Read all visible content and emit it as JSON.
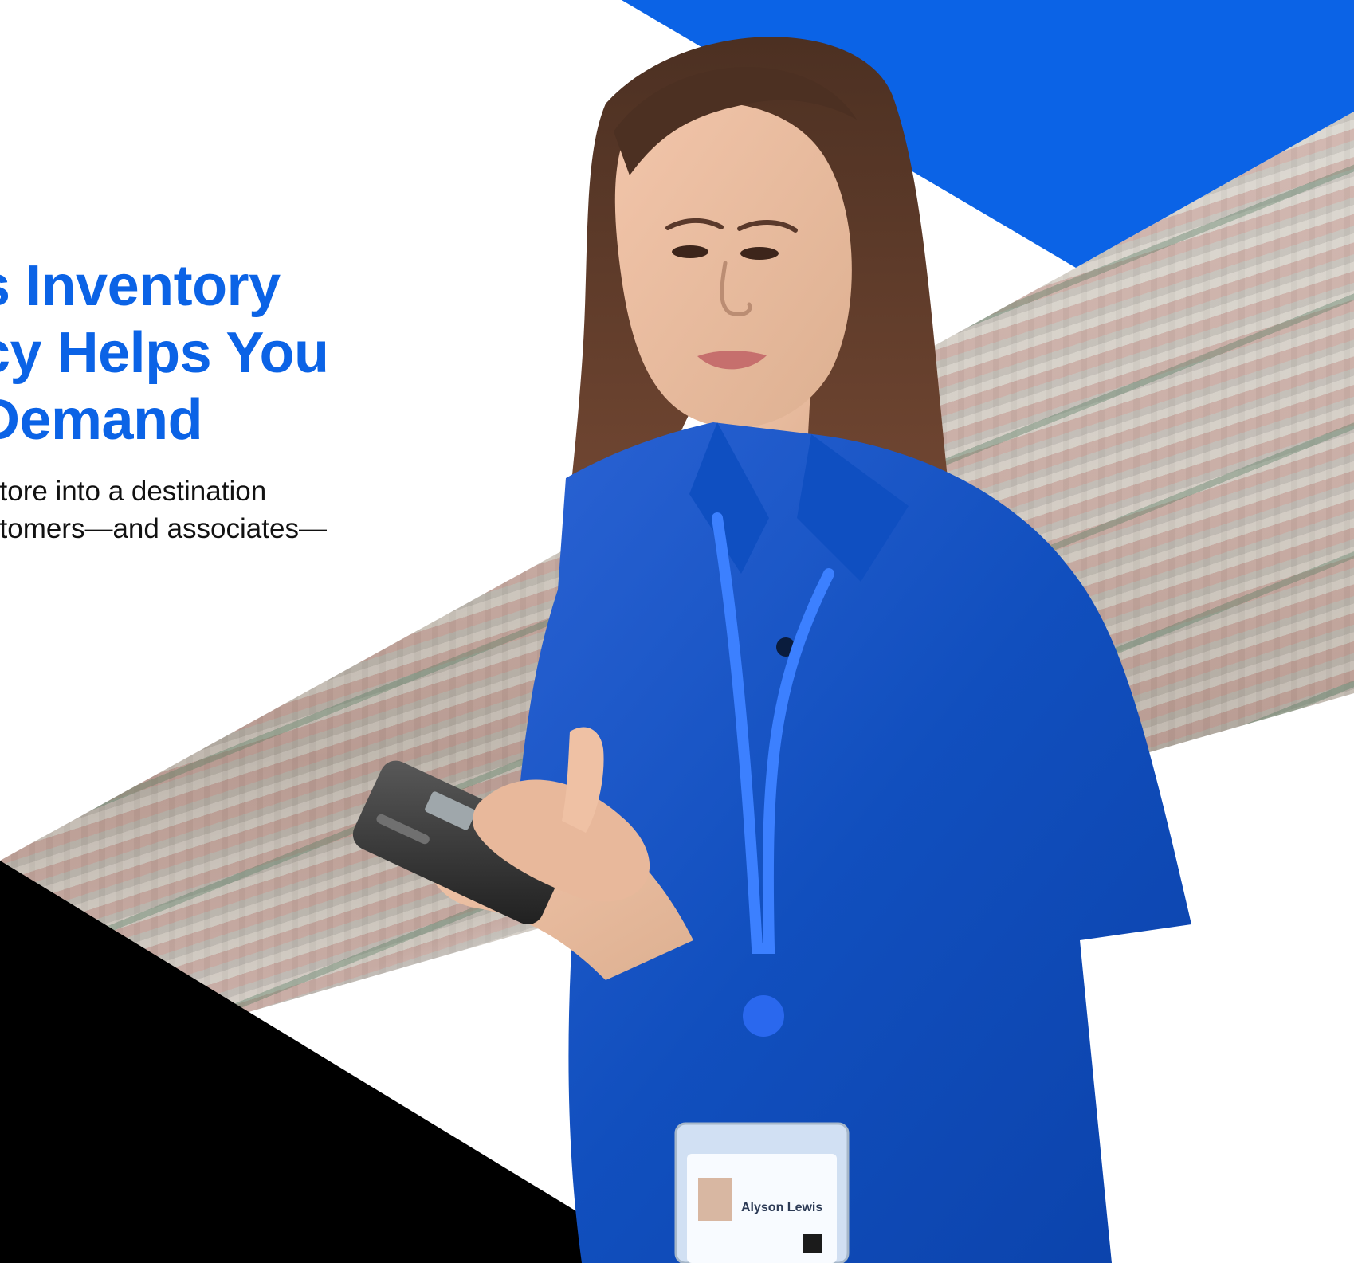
{
  "header": {
    "headline_lines": [
      "s Inventory",
      "cy Helps You",
      "Demand"
    ],
    "subhead_lines": [
      " store into a destination",
      "stomers—and associates—"
    ]
  },
  "badge": {
    "name": "Alyson Lewis"
  },
  "colors": {
    "brand_blue": "#0b63e6",
    "black": "#000000",
    "white": "#ffffff"
  }
}
